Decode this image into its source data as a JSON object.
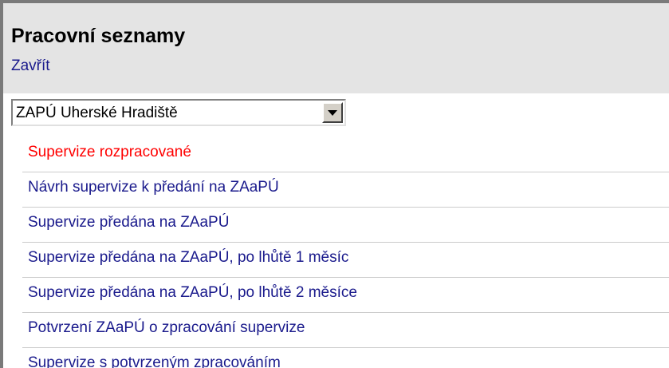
{
  "header": {
    "title": "Pracovní seznamy",
    "close_link": "Zavřít"
  },
  "workplace_select": {
    "value": "ZAPÚ Uherské Hradiště"
  },
  "worklists": {
    "items": [
      {
        "label": "Supervize rozpracované",
        "active": true
      },
      {
        "label": "Návrh supervize k předání na ZAaPÚ",
        "active": false
      },
      {
        "label": "Supervize předána na ZAaPÚ",
        "active": false
      },
      {
        "label": "Supervize předána na ZAaPÚ, po lhůtě 1 měsíc",
        "active": false
      },
      {
        "label": "Supervize předána na ZAaPÚ, po lhůtě 2 měsíce",
        "active": false
      },
      {
        "label": "Potvrzení ZAaPÚ o zpracování supervize",
        "active": false
      },
      {
        "label": "Supervize s potvrzeným zpracováním",
        "active": false
      }
    ]
  },
  "colors": {
    "active_item": "#ff0000",
    "link": "#1a1a8c",
    "header_bg": "#e4e4e4"
  }
}
